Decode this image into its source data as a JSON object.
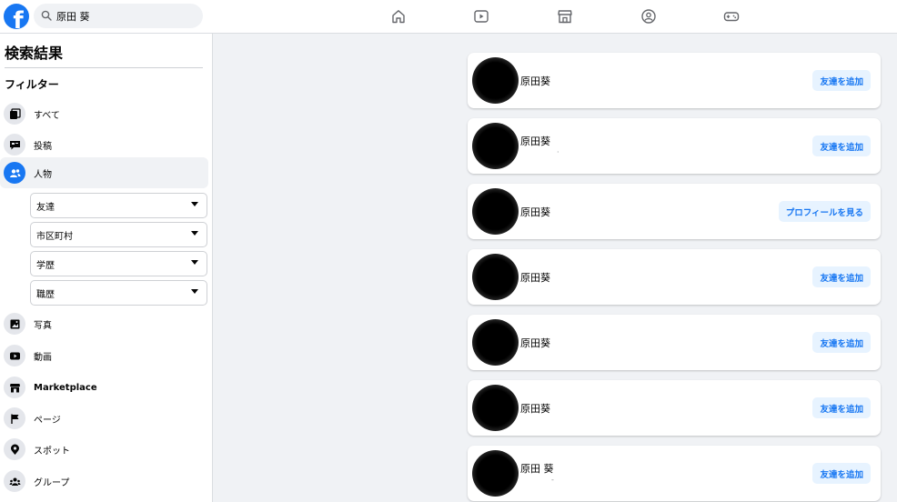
{
  "header": {
    "logo_letter": "f",
    "search_value": "原田 葵",
    "nav": [
      "home-icon",
      "watch-icon",
      "marketplace-icon",
      "groups-icon",
      "gaming-icon"
    ]
  },
  "sidebar": {
    "title": "検索結果",
    "filters_title": "フィルター",
    "items": [
      {
        "label": "すべて",
        "icon": "all-icon"
      },
      {
        "label": "投稿",
        "icon": "posts-icon"
      },
      {
        "label": "人物",
        "icon": "people-icon"
      },
      {
        "label": "写真",
        "icon": "photos-icon"
      },
      {
        "label": "動画",
        "icon": "videos-icon"
      },
      {
        "label": "Marketplace",
        "icon": "marketplace-icon"
      },
      {
        "label": "ページ",
        "icon": "pages-icon"
      },
      {
        "label": "スポット",
        "icon": "places-icon"
      },
      {
        "label": "グループ",
        "icon": "groups-icon"
      }
    ],
    "subfilters": [
      {
        "label": "友達"
      },
      {
        "label": "市区町村"
      },
      {
        "label": "学歴"
      },
      {
        "label": "職歴"
      }
    ]
  },
  "results": [
    {
      "name": "原田葵",
      "sub": "",
      "action": "友達を追加"
    },
    {
      "name": "原田葵",
      "sub": "·",
      "action": "友達を追加"
    },
    {
      "name": "原田葵",
      "sub": "",
      "action": "プロフィールを見る"
    },
    {
      "name": "原田葵",
      "sub": "",
      "action": "友達を追加"
    },
    {
      "name": "原田葵",
      "sub": "",
      "action": "友達を追加"
    },
    {
      "name": "原田葵",
      "sub": "",
      "action": "友達を追加"
    },
    {
      "name": "原田 葵",
      "sub": "-",
      "action": "友達を追加"
    }
  ],
  "colors": {
    "accent": "#1877f2",
    "button_bg": "#e7f3ff",
    "page_bg": "#f0f2f5"
  }
}
